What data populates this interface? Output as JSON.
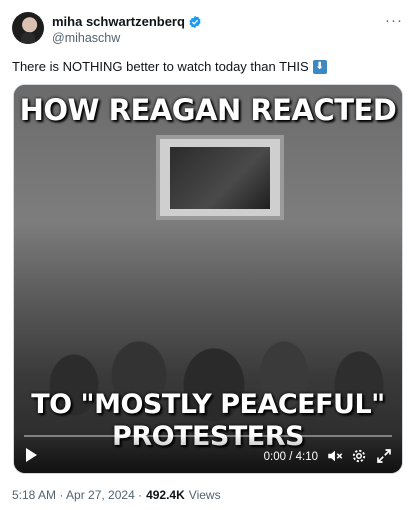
{
  "author": {
    "display_name": "miha schwartzenberq",
    "handle": "@mihaschw",
    "verified_icon": "verified-badge-icon"
  },
  "more_icon": "more-icon",
  "more_label": "···",
  "tweet": {
    "text": "There is NOTHING better to watch today than THIS",
    "emoji": "⬇"
  },
  "video": {
    "headline_top": "HOW REAGAN REACTED",
    "headline_bottom_1": "TO \"MOSTLY PEACEFUL\"",
    "headline_bottom_2": "PROTESTERS",
    "time_display": "0:00 / 4:10",
    "icons": {
      "play": "play-icon",
      "volume": "volume-icon",
      "settings": "gear-icon",
      "fullscreen": "fullscreen-icon"
    }
  },
  "meta": {
    "timestamp": "5:18 AM · Apr 27, 2024 ·",
    "views_count": "492.4K",
    "views_label": "Views"
  },
  "colors": {
    "text_primary": "#0f1419",
    "text_secondary": "#536471",
    "verified_blue": "#1d9bf0",
    "border": "#cfd9de"
  }
}
